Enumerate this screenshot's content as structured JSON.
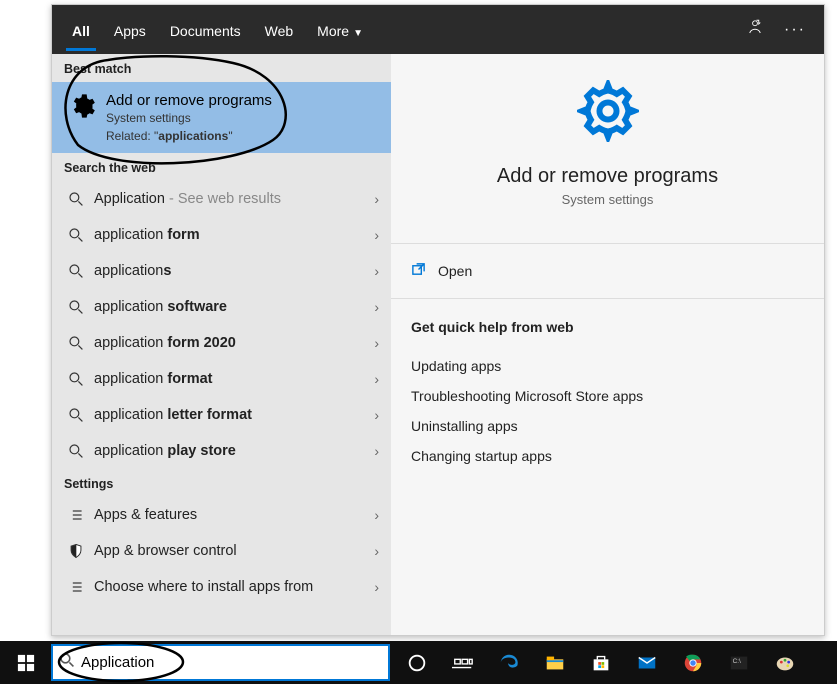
{
  "tabs": {
    "all": "All",
    "apps": "Apps",
    "documents": "Documents",
    "web": "Web",
    "more": "More"
  },
  "groups": {
    "best_match": "Best match",
    "search_web": "Search the web",
    "settings": "Settings"
  },
  "best": {
    "title": "Add or remove programs",
    "sub": "System settings",
    "related_prefix": "Related: \"",
    "related_term": "applications",
    "related_suffix": "\""
  },
  "web_items": [
    {
      "plain": "Application",
      "bold": "",
      "hint": " - See web results"
    },
    {
      "plain": "application ",
      "bold": "form",
      "hint": ""
    },
    {
      "plain": "application",
      "bold": "s",
      "hint": ""
    },
    {
      "plain": "application ",
      "bold": "software",
      "hint": ""
    },
    {
      "plain": "application ",
      "bold": "form 2020",
      "hint": ""
    },
    {
      "plain": "application ",
      "bold": "format",
      "hint": ""
    },
    {
      "plain": "application ",
      "bold": "letter format",
      "hint": ""
    },
    {
      "plain": "application ",
      "bold": "play store",
      "hint": ""
    }
  ],
  "settings_items": [
    {
      "icon": "list",
      "label": "Apps & features"
    },
    {
      "icon": "shield",
      "label": "App & browser control"
    },
    {
      "icon": "list",
      "label": "Choose where to install apps from"
    }
  ],
  "detail": {
    "title": "Add or remove programs",
    "sub": "System settings",
    "open": "Open",
    "quick_title": "Get quick help from web",
    "links": [
      "Updating apps",
      "Troubleshooting Microsoft Store apps",
      "Uninstalling apps",
      "Changing startup apps"
    ]
  },
  "search_value": "Application"
}
